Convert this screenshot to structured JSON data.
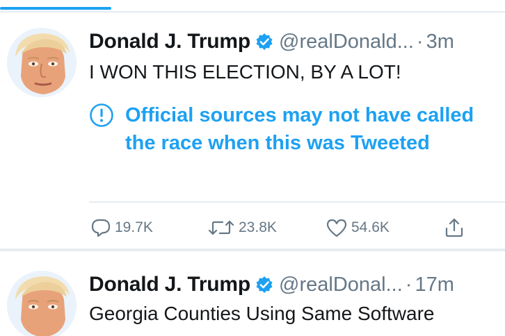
{
  "tweets": [
    {
      "name": "Donald J. Trump",
      "handle": "@realDonald...",
      "separator": "·",
      "time": "3m",
      "text": "I WON THIS ELECTION, BY A LOT!",
      "notice": "Official sources may not have called the race when this was Tweeted",
      "actions": {
        "reply_count": "19.7K",
        "retweet_count": "23.8K",
        "like_count": "54.6K"
      }
    },
    {
      "name": "Donald J. Trump",
      "handle": "@realDonal...",
      "separator": "·",
      "time": "17m",
      "text": "Georgia Counties Using Same Software"
    }
  ],
  "colors": {
    "accent": "#1da1f2",
    "muted": "#657786",
    "text": "#14171a",
    "divider": "#e6ecf0"
  },
  "icons": {
    "verified": "verified-badge-icon",
    "notice": "exclamation-circle-icon",
    "reply": "comment-icon",
    "retweet": "retweet-icon",
    "like": "heart-icon",
    "share": "share-icon"
  }
}
